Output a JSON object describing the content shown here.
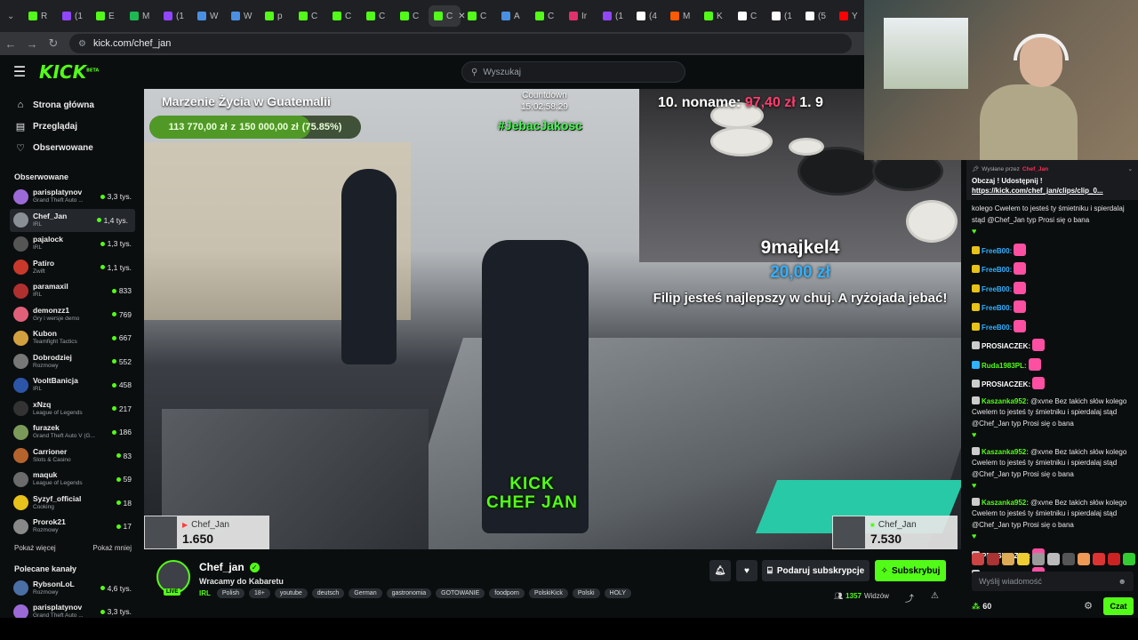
{
  "browser": {
    "tabs": [
      {
        "label": "R",
        "color": "#53fc18"
      },
      {
        "label": "(1",
        "color": "#9146ff"
      },
      {
        "label": "E",
        "color": "#53fc18"
      },
      {
        "label": "M",
        "color": "#1db954"
      },
      {
        "label": "(1",
        "color": "#9146ff"
      },
      {
        "label": "W",
        "color": "#4a90e2"
      },
      {
        "label": "W",
        "color": "#4a90e2"
      },
      {
        "label": "p",
        "color": "#53fc18"
      },
      {
        "label": "C",
        "color": "#53fc18"
      },
      {
        "label": "C",
        "color": "#53fc18"
      },
      {
        "label": "C",
        "color": "#53fc18"
      },
      {
        "label": "C",
        "color": "#53fc18"
      },
      {
        "label": "C",
        "color": "#53fc18",
        "active": true
      },
      {
        "label": "C",
        "color": "#53fc18"
      },
      {
        "label": "A",
        "color": "#4a90e2"
      },
      {
        "label": "C",
        "color": "#53fc18"
      },
      {
        "label": "Ir",
        "color": "#e1306c"
      },
      {
        "label": "(1",
        "color": "#9146ff"
      },
      {
        "label": "(4",
        "color": "#ffffff"
      },
      {
        "label": "M",
        "color": "#ff5a00"
      },
      {
        "label": "K",
        "color": "#53fc18"
      },
      {
        "label": "C",
        "color": "#ffffff"
      },
      {
        "label": "(1",
        "color": "#ffffff"
      },
      {
        "label": "(5",
        "color": "#ffffff"
      },
      {
        "label": "Y",
        "color": "#ff0000"
      }
    ],
    "url": "kick.com/chef_jan"
  },
  "header": {
    "logo": "KICK",
    "logo_badge": "BETA",
    "search_placeholder": "Wyszukaj"
  },
  "sidebar": {
    "nav": [
      {
        "label": "Strona główna",
        "icon": "home-icon"
      },
      {
        "label": "Przeglądaj",
        "icon": "browse-icon"
      },
      {
        "label": "Obserwowane",
        "icon": "heart-icon"
      }
    ],
    "followed_title": "Obserwowane",
    "followed": [
      {
        "name": "parisplatynov",
        "category": "Grand Theft Auto ...",
        "viewers": "3,3 tys.",
        "color": "#9b6ad6"
      },
      {
        "name": "Chef_Jan",
        "category": "IRL",
        "viewers": "1,4 tys.",
        "color": "#8a8f96",
        "selected": true
      },
      {
        "name": "pajalock",
        "category": "IRL",
        "viewers": "1,3 tys.",
        "color": "#555"
      },
      {
        "name": "Patiro",
        "category": "Zwift",
        "viewers": "1,1 tys.",
        "color": "#c8392b"
      },
      {
        "name": "paramaxil",
        "category": "IRL",
        "viewers": "833",
        "color": "#b03030"
      },
      {
        "name": "demonzz1",
        "category": "Gry i wersje demo",
        "viewers": "769",
        "color": "#e0607a"
      },
      {
        "name": "Kubon",
        "category": "Teamfight Tactics",
        "viewers": "667",
        "color": "#d3a040"
      },
      {
        "name": "Dobrodziej",
        "category": "Rozmowy",
        "viewers": "552",
        "color": "#777"
      },
      {
        "name": "VooltBanicja",
        "category": "IRL",
        "viewers": "458",
        "color": "#2c55a8"
      },
      {
        "name": "xNzq",
        "category": "League of Legends",
        "viewers": "217",
        "color": "#333"
      },
      {
        "name": "furazek",
        "category": "Grand Theft Auto V (G...",
        "viewers": "186",
        "color": "#7b9a5a"
      },
      {
        "name": "Carrioner",
        "category": "Slots & Casino",
        "viewers": "83",
        "color": "#b5632d"
      },
      {
        "name": "maquk",
        "category": "League of Legends",
        "viewers": "59",
        "color": "#6b6b6b"
      },
      {
        "name": "Syzyf_official",
        "category": "Cooking",
        "viewers": "18",
        "color": "#e6c21a"
      },
      {
        "name": "Prorok21",
        "category": "Rozmowy",
        "viewers": "17",
        "color": "#888"
      }
    ],
    "show_more": "Pokaż więcej",
    "show_less": "Pokaż mniej",
    "recommended_title": "Polecane kanały",
    "recommended": [
      {
        "name": "RybsonLoL",
        "category": "Rozmowy",
        "viewers": "4,6 tys.",
        "color": "#4a6fa5"
      },
      {
        "name": "parisplatynov",
        "category": "Grand Theft Auto ...",
        "viewers": "3,3 tys.",
        "color": "#9b6ad6"
      }
    ]
  },
  "video": {
    "goal_title": "Marzenie Życia w Guatemalii",
    "goal_current": "113 770,00 zł",
    "goal_sep": "z",
    "goal_target": "150 000,00 zł",
    "goal_pct_text": "(75.85%)",
    "goal_pct": 0.7585,
    "countdown_label": "Countdown",
    "countdown_value": "15:02:58:29",
    "hashtag": "#JebacJakosc",
    "rank_text": "10. noname:",
    "rank_amount": "97,40 zł",
    "rank_next": "1. 9",
    "donor_name": "9majkel4",
    "donor_amount": "20,00 zł",
    "donor_message": "Filip jesteś najlepszy w chuj. A ryżojada jebać!",
    "brand_line1": "KICK",
    "brand_line2": "CHEF JAN",
    "sub_left": {
      "name": "Chef_Jan",
      "value": "1.650"
    },
    "sub_right": {
      "name": "Chef_Jan",
      "value": "7.530"
    }
  },
  "stream": {
    "name": "Chef_jan",
    "live": "LIVE",
    "title": "Wracamy do Kabaretu",
    "category": "IRL",
    "tags": [
      "Polish",
      "18+",
      "youtube",
      "deutsch",
      "German",
      "gastronomia",
      "GOTOWANIE",
      "foodporn",
      "PolskiKick",
      "Polski",
      "HOLY"
    ],
    "gift_label": "Podaruj subskrypcje",
    "subscribe_label": "Subskrybuj",
    "viewers_count": "1357",
    "viewers_label": "Widzów"
  },
  "chat": {
    "pinned_prefix": "Wysłane przez",
    "pinned_by": "Chef_Jan",
    "pinned_message": "Obczaj ! Udostępnij !",
    "pinned_link": "https://kick.com/chef_jan/clips/clip_0...",
    "messages": [
      {
        "user": "",
        "text": "kolego Cwelem to jesteś ty śmietniku i spierdalaj stąd @Chef_Jan typ Prosi się o bana",
        "heart": true,
        "user_color": "#53fc18"
      },
      {
        "user": "FreeB00:",
        "text": "",
        "emote": true,
        "user_color": "#31b0ff",
        "badge": "#e6c21a"
      },
      {
        "user": "FreeB00:",
        "text": "",
        "emote": true,
        "user_color": "#31b0ff",
        "badge": "#e6c21a"
      },
      {
        "user": "FreeB00:",
        "text": "",
        "emote": true,
        "user_color": "#31b0ff",
        "badge": "#e6c21a"
      },
      {
        "user": "FreeB00:",
        "text": "",
        "emote": true,
        "user_color": "#31b0ff",
        "badge": "#e6c21a"
      },
      {
        "user": "FreeB00:",
        "text": "",
        "emote": true,
        "user_color": "#31b0ff",
        "badge": "#e6c21a"
      },
      {
        "user": "PROSIACZEK:",
        "text": "",
        "emote": true,
        "user_color": "#ffffff",
        "badge": "#cccccc"
      },
      {
        "user": "Ruda1983PL:",
        "text": "",
        "emote": true,
        "user_color": "#53fc18",
        "badge": "#31b0ff"
      },
      {
        "user": "PROSIACZEK:",
        "text": "",
        "emote": true,
        "user_color": "#ffffff",
        "badge": "#cccccc"
      },
      {
        "user": "Kaszanka952:",
        "text": "@xvne Bez takich słów kolego Cwelem to jesteś ty śmietniku i spierdalaj stąd @Chef_Jan typ Prosi się o bana",
        "heart": true,
        "user_color": "#53fc18",
        "badge": "#cccccc"
      },
      {
        "user": "Kaszanka952:",
        "text": "@xvne Bez takich słów kolego Cwelem to jesteś ty śmietniku i spierdalaj stąd @Chef_Jan typ Prosi się o bana",
        "heart": true,
        "user_color": "#53fc18",
        "badge": "#cccccc"
      },
      {
        "user": "Kaszanka952:",
        "text": "@xvne Bez takich słów kolego Cwelem to jesteś ty śmietniku i spierdalaj stąd @Chef_Jan typ Prosi się o bana",
        "heart": true,
        "user_color": "#53fc18",
        "badge": "#cccccc"
      },
      {
        "user": "PROSIACZEK:",
        "text": "",
        "emote": true,
        "user_color": "#ffffff",
        "badge": "#cccccc"
      },
      {
        "user": "PROSIACZEK:",
        "text": "",
        "emote": true,
        "user_color": "#ffffff",
        "badge": "#cccccc"
      }
    ],
    "emote_colors": [
      "#c44",
      "#a33",
      "#da5",
      "#ec3",
      "#999",
      "#bbb",
      "#555",
      "#e95",
      "#d33",
      "#c22",
      "#3c3",
      "#2a2"
    ],
    "input_placeholder": "Wyślij wiadomość",
    "points": "60",
    "send_label": "Czat"
  }
}
